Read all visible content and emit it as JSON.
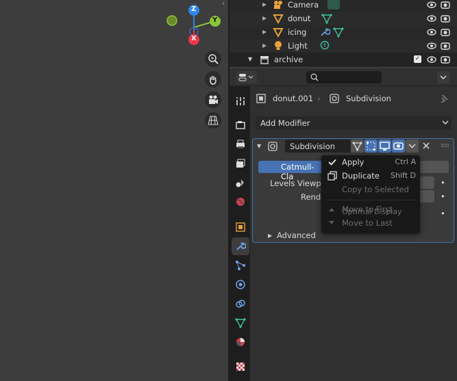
{
  "gizmo": {
    "z": "Z",
    "y": "Y",
    "x": "X"
  },
  "outliner": {
    "rows": [
      {
        "label": "Camera"
      },
      {
        "label": "donut"
      },
      {
        "label": "icing"
      },
      {
        "label": "Light"
      },
      {
        "label": "archive"
      }
    ]
  },
  "header": {
    "search_placeholder": ""
  },
  "breadcrumb": {
    "object": "donut.001",
    "modifier": "Subdivision"
  },
  "add_modifier_label": "Add Modifier",
  "modifier": {
    "name": "Subdivision",
    "catmull_label": "Catmull-Cla",
    "simple_label": "S",
    "levels_viewport_label": "Levels Viewpor",
    "render_label": "Rende",
    "optimal_display_label": "Optimal Display",
    "advanced_label": "Advanced"
  },
  "context_menu": {
    "items": [
      {
        "label": "Apply",
        "shortcut": "Ctrl A",
        "enabled": true
      },
      {
        "label": "Duplicate",
        "shortcut": "Shift D",
        "enabled": true
      },
      {
        "label": "Copy to Selected",
        "shortcut": "",
        "enabled": false
      },
      {
        "label": "Move to First",
        "shortcut": "",
        "enabled": false
      },
      {
        "label": "Move to Last",
        "shortcut": "",
        "enabled": false
      }
    ]
  },
  "colors": {
    "accent_blue": "#4772b3",
    "x_axis": "#e8364e",
    "y_axis": "#8ac43a",
    "z_axis": "#2f86e8",
    "mesh_green": "#3ec1a0",
    "object_orange": "#e8a23a"
  }
}
